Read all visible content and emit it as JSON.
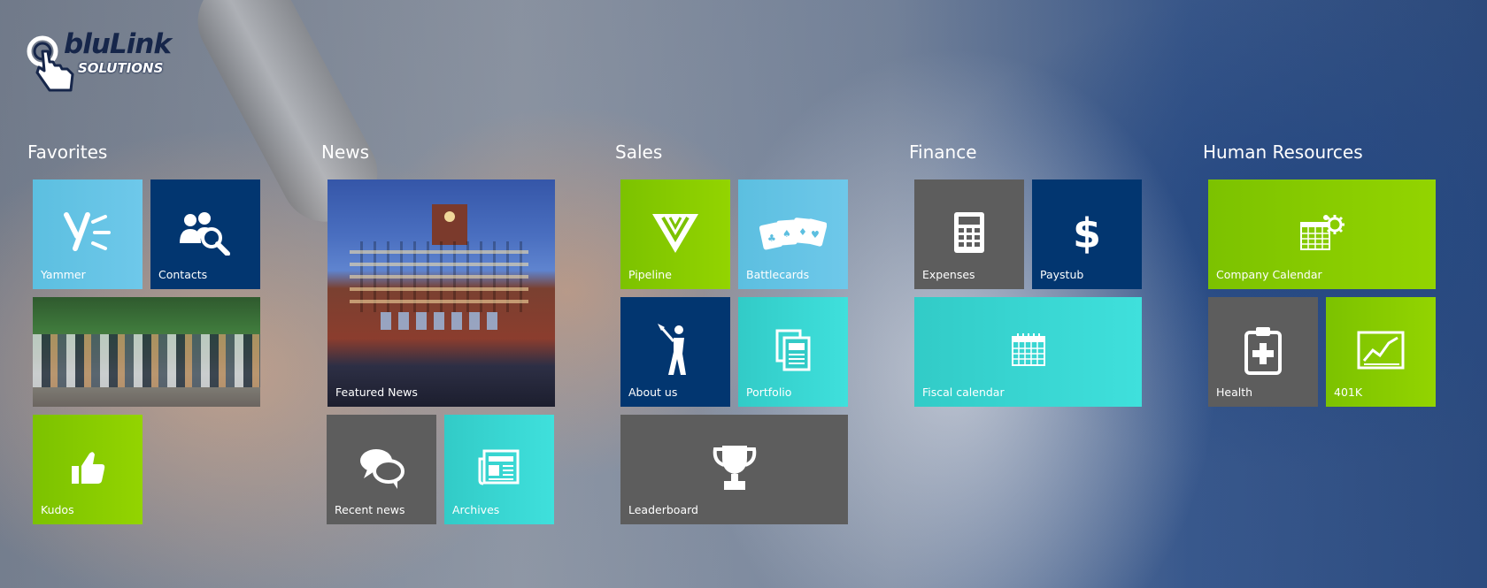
{
  "brand": {
    "name_line1": "bluLink",
    "name_line2": "SOLUTIONS"
  },
  "groups": [
    {
      "title": "Favorites",
      "tiles": [
        {
          "label": "Yammer",
          "icon": "yammer-icon"
        },
        {
          "label": "Contacts",
          "icon": "contacts-search-icon"
        },
        {
          "label": "",
          "icon": "team-photo"
        },
        {
          "label": "Kudos",
          "icon": "thumbs-up-icon"
        }
      ]
    },
    {
      "title": "News",
      "tiles": [
        {
          "label": "Featured News",
          "icon": "headquarters-photo"
        },
        {
          "label": "Recent news",
          "icon": "chat-bubbles-icon"
        },
        {
          "label": "Archives",
          "icon": "newspaper-icon"
        }
      ]
    },
    {
      "title": "Sales",
      "tiles": [
        {
          "label": "Pipeline",
          "icon": "funnel-icon"
        },
        {
          "label": "Battlecards",
          "icon": "playing-cards-icon"
        },
        {
          "label": "About us",
          "icon": "golfer-icon"
        },
        {
          "label": "Portfolio",
          "icon": "documents-icon"
        },
        {
          "label": "Leaderboard",
          "icon": "trophy-icon"
        }
      ]
    },
    {
      "title": "Finance",
      "tiles": [
        {
          "label": "Expenses",
          "icon": "calculator-icon"
        },
        {
          "label": "Paystub",
          "icon": "dollar-icon"
        },
        {
          "label": "Fiscal calendar",
          "icon": "calendar-icon"
        }
      ]
    },
    {
      "title": "Human Resources",
      "tiles": [
        {
          "label": "Company Calendar",
          "icon": "calendar-gear-icon"
        },
        {
          "label": "Health",
          "icon": "clipboard-plus-icon"
        },
        {
          "label": "401K",
          "icon": "line-chart-icon"
        }
      ]
    }
  ],
  "colors": {
    "light_blue": "#5cbfe0",
    "navy": "#023670",
    "green": "#7cc200",
    "gray": "#5d5d5d",
    "teal": "#32cbc7"
  }
}
